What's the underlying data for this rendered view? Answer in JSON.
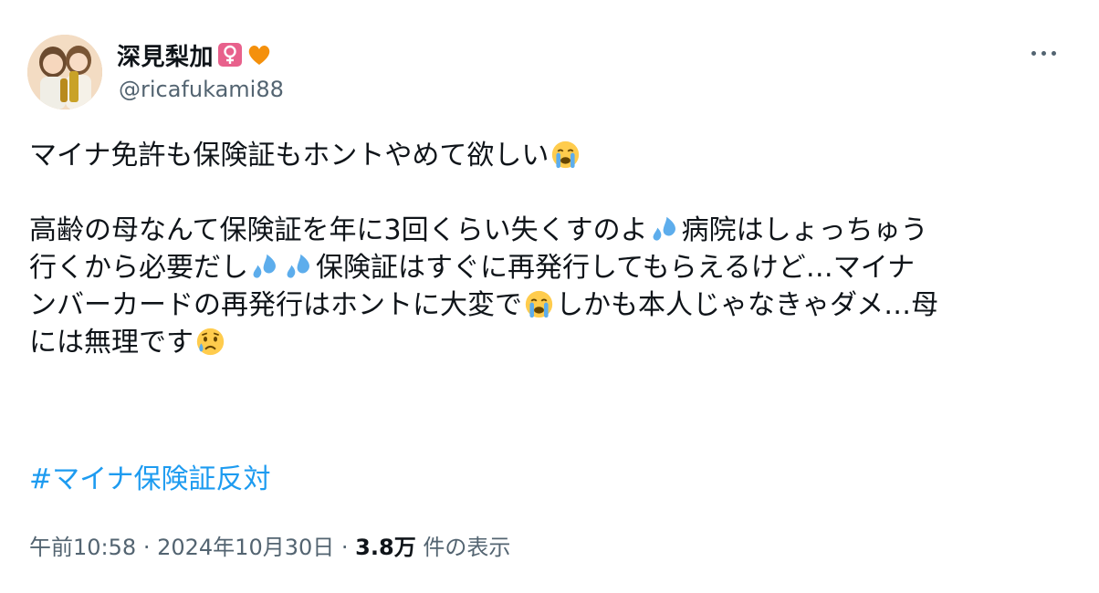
{
  "author": {
    "display_name": "深見梨加",
    "handle": "@ricafukami88",
    "badges": [
      "female-sign-icon",
      "orange-heart-icon"
    ]
  },
  "tweet": {
    "paragraph1": {
      "text": "マイナ免許も保険証もホントやめて欲しい",
      "emoji": "loudly-crying-face-icon"
    },
    "paragraph2": {
      "line1_a": "高齢の母なんて保険証を年に3回くらい失くすのよ",
      "line1_b": "病院はしょっちゅう",
      "line2_a": "行くから必要だし",
      "line2_b": "保険証はすぐに再発行してもらえるけど…マイナ",
      "line3_a": "ンバーカードの再発行はホントに大変で",
      "line3_b": "しかも本人じゃなきゃダメ…母",
      "line4_a": "には無理です"
    },
    "hashtag": "#マイナ保険証反対"
  },
  "meta": {
    "time": "午前10:58",
    "separator": "·",
    "date": "2024年10月30日",
    "views_count": "3.8万",
    "views_label": "件の表示"
  },
  "colors": {
    "link": "#1d9bf0",
    "secondary_text": "#536471",
    "primary_text": "#0f1419"
  }
}
